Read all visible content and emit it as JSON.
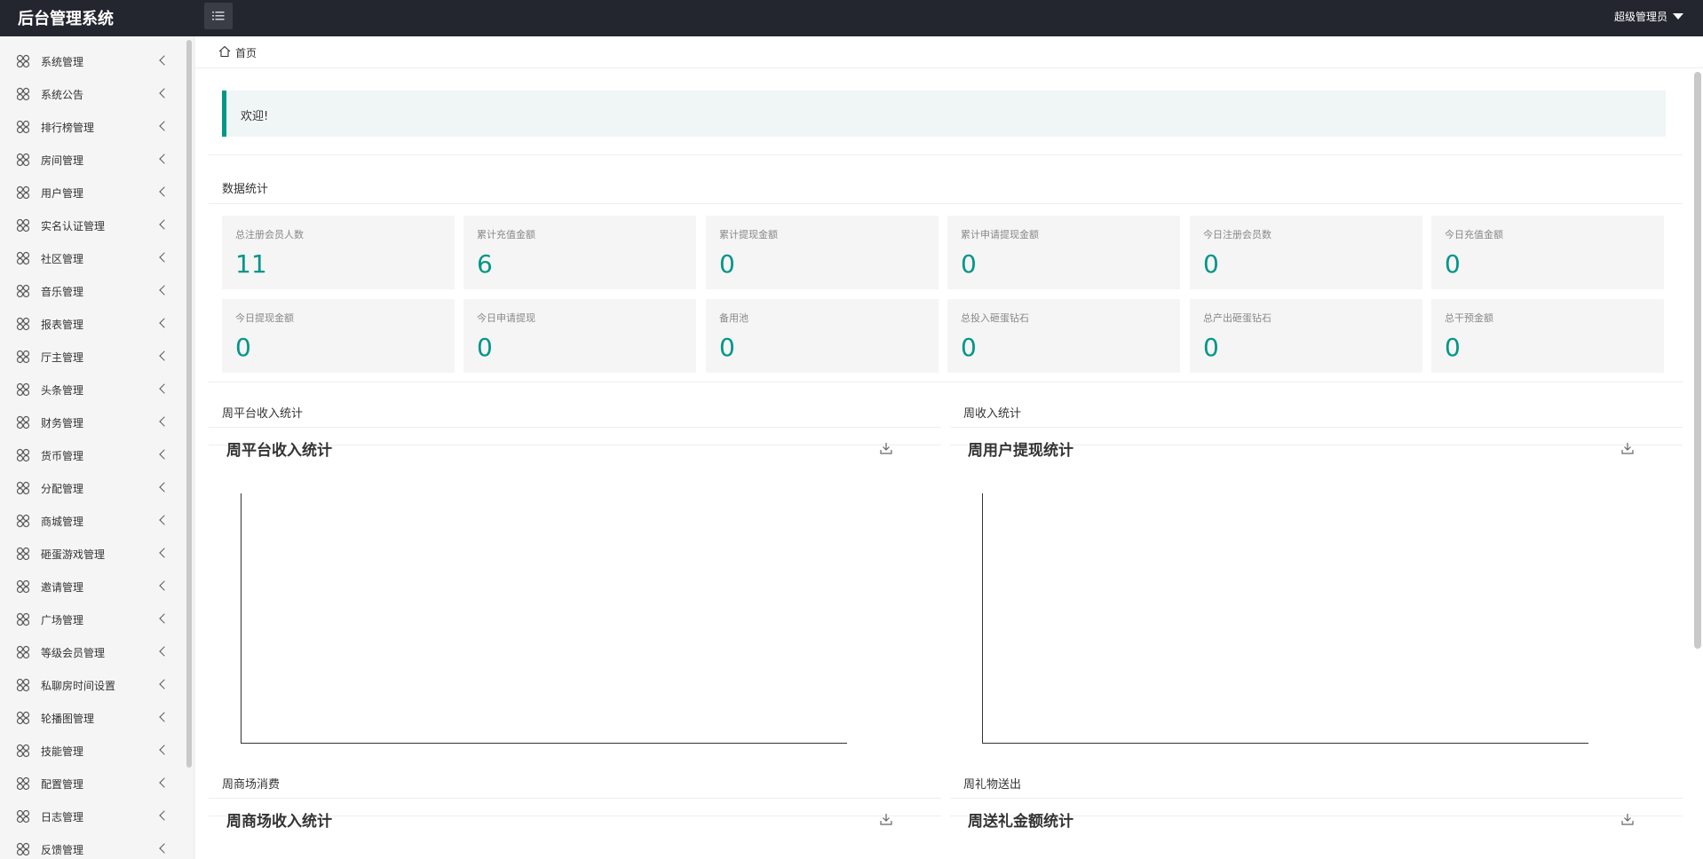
{
  "header": {
    "app_title": "后台管理系统",
    "user_name": "超级管理员"
  },
  "sidebar": {
    "items": [
      {
        "label": "系统管理"
      },
      {
        "label": "系统公告"
      },
      {
        "label": "排行榜管理"
      },
      {
        "label": "房间管理"
      },
      {
        "label": "用户管理"
      },
      {
        "label": "实名认证管理"
      },
      {
        "label": "社区管理"
      },
      {
        "label": "音乐管理"
      },
      {
        "label": "报表管理"
      },
      {
        "label": "厅主管理"
      },
      {
        "label": "头条管理"
      },
      {
        "label": "财务管理"
      },
      {
        "label": "货币管理"
      },
      {
        "label": "分配管理"
      },
      {
        "label": "商城管理"
      },
      {
        "label": "砸蛋游戏管理"
      },
      {
        "label": "邀请管理"
      },
      {
        "label": "广场管理"
      },
      {
        "label": "等级会员管理"
      },
      {
        "label": "私聊房时间设置"
      },
      {
        "label": "轮播图管理"
      },
      {
        "label": "技能管理"
      },
      {
        "label": "配置管理"
      },
      {
        "label": "日志管理"
      },
      {
        "label": "反馈管理"
      }
    ]
  },
  "breadcrumb": {
    "home": "首页"
  },
  "welcome": {
    "text": "欢迎!"
  },
  "stats": {
    "title": "数据统计",
    "cards": [
      {
        "label": "总注册会员人数",
        "value": "11"
      },
      {
        "label": "累计充值金额",
        "value": "6"
      },
      {
        "label": "累计提现金额",
        "value": "0"
      },
      {
        "label": "累计申请提现金额",
        "value": "0"
      },
      {
        "label": "今日注册会员数",
        "value": "0"
      },
      {
        "label": "今日充值金额",
        "value": "0"
      },
      {
        "label": "今日提现金额",
        "value": "0"
      },
      {
        "label": "今日申请提现",
        "value": "0"
      },
      {
        "label": "备用池",
        "value": "0"
      },
      {
        "label": "总投入砸蛋钻石",
        "value": "0"
      },
      {
        "label": "总产出砸蛋钻石",
        "value": "0"
      },
      {
        "label": "总干预金额",
        "value": "0"
      }
    ]
  },
  "panels": [
    {
      "section": "周平台收入统计",
      "chart_title": "周平台收入统计"
    },
    {
      "section": "周收入统计",
      "chart_title": "周用户提现统计"
    },
    {
      "section": "周商场消费",
      "chart_title": "周商场收入统计"
    },
    {
      "section": "周礼物送出",
      "chart_title": "周送礼金额统计"
    }
  ],
  "colors": {
    "accent": "#009688",
    "header_bg": "#23262e",
    "sidebar_bg": "#f5f5f5"
  },
  "icons": {
    "menu_toggle": "list-icon",
    "sidebar_item": "flower-icon",
    "home": "home-icon",
    "download": "download-icon"
  }
}
